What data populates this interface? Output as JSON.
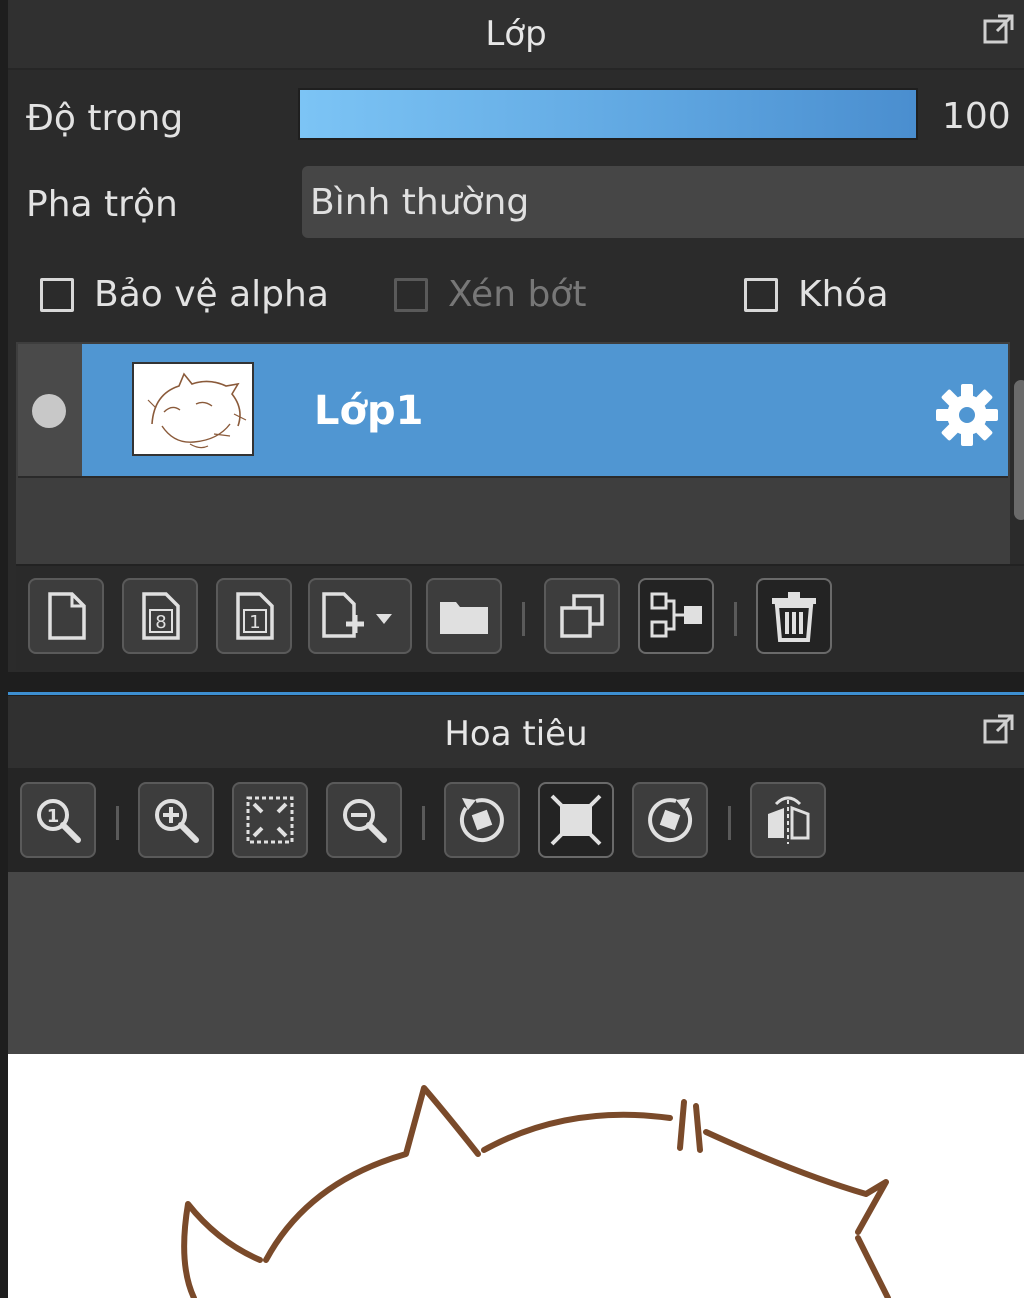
{
  "layer_panel": {
    "title": "Lớp",
    "opacity_label": "Độ trong",
    "opacity_value": "100 %",
    "opacity_percent": 100,
    "blend_label": "Pha trộn",
    "blend_value": "Bình thường",
    "checkboxes": [
      {
        "label": "Bảo vệ alpha",
        "checked": false,
        "enabled": true
      },
      {
        "label": "Xén bớt",
        "checked": false,
        "enabled": false
      },
      {
        "label": "Khóa",
        "checked": false,
        "enabled": true
      }
    ],
    "layers": [
      {
        "name": "Lớp1",
        "selected": true,
        "visible": true
      }
    ],
    "toolbar_icons": [
      "new-layer-icon",
      "new-8bit-layer-icon",
      "new-1bit-layer-icon",
      "add-layer-dropdown-icon",
      "new-folder-icon",
      "duplicate-layer-icon",
      "merge-down-icon",
      "delete-layer-icon"
    ]
  },
  "navigator_panel": {
    "title": "Hoa tiêu",
    "toolbar_icons": [
      "zoom-actual-icon",
      "zoom-in-icon",
      "fit-window-icon",
      "zoom-out-icon",
      "rotate-left-icon",
      "reset-view-icon",
      "rotate-right-icon",
      "flip-horizontal-icon"
    ]
  },
  "colors": {
    "accent": "#5096d2",
    "panel_bg": "#2b2b2b",
    "drawing_line": "#7a4a2a"
  }
}
